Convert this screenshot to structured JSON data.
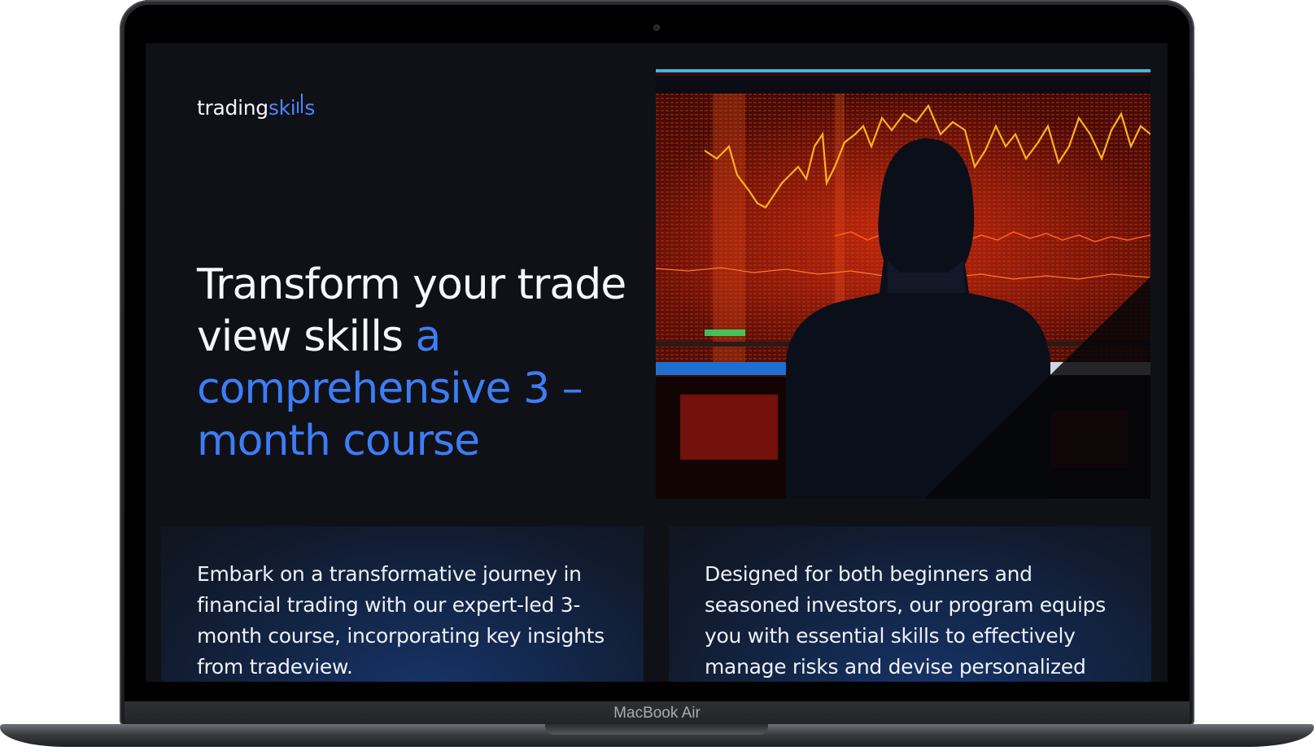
{
  "brand": {
    "logo_part1": "trading",
    "logo_part2": "ski",
    "logo_part3": "s"
  },
  "hero": {
    "headline_white": "Transform your trade view skills ",
    "headline_blue": "a comprehensive 3 – month course",
    "image_icon": "trader-monitor-image"
  },
  "cards": [
    {
      "text": "Embark on a transformative journey in financial trading with our expert-led 3-month course, incorporating key insights from tradeview."
    },
    {
      "text": "Designed for both beginners and seasoned investors, our program equips you with essential skills to effectively manage risks and devise personalized"
    }
  ],
  "device": {
    "model_label": "MacBook Air"
  },
  "colors": {
    "background": "#0f1117",
    "accent": "#3d7df5",
    "text": "#f5f7fb"
  }
}
